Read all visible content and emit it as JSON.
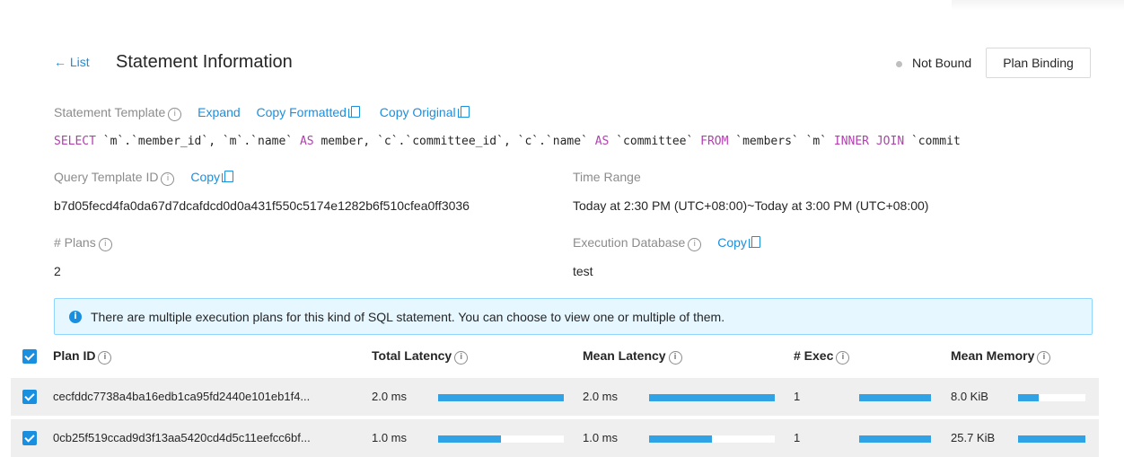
{
  "header": {
    "back_label": "← List",
    "title": "Statement Information",
    "bound_status": "Not Bound",
    "plan_binding_button": "Plan Binding"
  },
  "statement_template": {
    "label": "Statement Template",
    "expand": "Expand",
    "copy_formatted": "Copy Formatted",
    "copy_original": "Copy Original",
    "sql": "SELECT `m`.`member_id`, `m`.`name` AS member, `c`.`committee_id`, `c`.`name` AS `committee` FROM `members` `m` INNER JOIN `commit"
  },
  "query_template_id": {
    "label": "Query Template ID",
    "copy": "Copy",
    "value": "b7d05fecd4fa0da67d7dcafdcd0d0a431f550c5174e1282b6f510cfea0ff3036"
  },
  "time_range": {
    "label": "Time Range",
    "value": "Today at 2:30 PM (UTC+08:00)~Today at 3:00 PM (UTC+08:00)"
  },
  "plans": {
    "label": "# Plans",
    "value": "2"
  },
  "execution_database": {
    "label": "Execution Database",
    "copy": "Copy",
    "value": "test"
  },
  "alert": {
    "icon": "info-icon",
    "text": "There are multiple execution plans for this kind of SQL statement. You can choose to view one or multiple of them."
  },
  "table": {
    "columns": [
      "Plan ID",
      "Total Latency",
      "Mean Latency",
      "# Exec",
      "Mean Memory"
    ],
    "rows": [
      {
        "plan_id": "cecfddc7738a4ba16edb1ca95fd2440e101eb1f4...",
        "total_latency": "2.0 ms",
        "total_latency_fraction": 1.0,
        "mean_latency": "2.0 ms",
        "mean_latency_fraction": 1.0,
        "exec": "1",
        "exec_fraction": 1.0,
        "mean_memory": "8.0 KiB",
        "mean_memory_fraction": 0.31,
        "checked": true
      },
      {
        "plan_id": "0cb25f519ccad9d3f13aa5420cd4d5c11eefcc6bf...",
        "total_latency": "1.0 ms",
        "total_latency_fraction": 0.5,
        "mean_latency": "1.0 ms",
        "mean_latency_fraction": 0.5,
        "exec": "1",
        "exec_fraction": 1.0,
        "mean_memory": "25.7 KiB",
        "mean_memory_fraction": 1.0,
        "checked": true
      }
    ]
  },
  "colors": {
    "accent": "#1a8fe0",
    "bar": "#2fa3e6",
    "sql_keyword": "#b23fb0",
    "alert_bg": "#e6f7ff"
  }
}
